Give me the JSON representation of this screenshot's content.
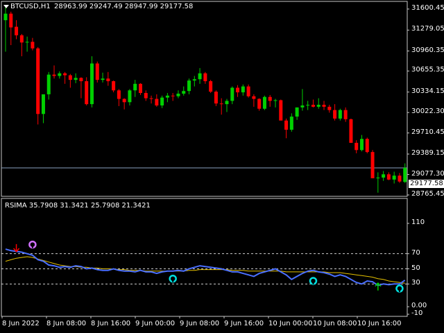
{
  "main_chart": {
    "symbol_label": "BTCUSD,H1",
    "ohlc_text": "28963.99 29247.49 28947.99 29177.58",
    "current_price": "29177.58",
    "y_labels": [
      "31600.45",
      "31279.05",
      "30960.35",
      "30655.35",
      "30334.15",
      "30022.30",
      "29710.45",
      "29389.15",
      "29077.30",
      "28765.45"
    ]
  },
  "indicator": {
    "label": "RSIMA 35.7908 31.3421 25.7908 21.3421",
    "y_labels": [
      "110",
      "70",
      "50",
      "30",
      "0.00",
      "-10"
    ]
  },
  "x_labels": [
    "8 Jun 2022",
    "8 Jun 08:00",
    "8 Jun 16:00",
    "9 Jun 00:00",
    "9 Jun 08:00",
    "9 Jun 16:00",
    "10 Jun 00:00",
    "10 Jun 08:00",
    "10 Jun 16:00"
  ],
  "colors": {
    "bull": "#00d000",
    "bear": "#ff0000",
    "rsi_line": "#4a6fff",
    "ma_line": "#e6c200",
    "grid": "#c8c8c8",
    "signal_cyan": "#00e0e0",
    "signal_violet": "#d070ff"
  },
  "chart_data": {
    "type": "candlestick",
    "candles": [
      {
        "o": 31430,
        "h": 31660,
        "l": 30950,
        "c": 31530
      },
      {
        "o": 31530,
        "h": 31560,
        "l": 31050,
        "c": 31320
      },
      {
        "o": 31330,
        "h": 31430,
        "l": 31140,
        "c": 31200
      },
      {
        "o": 31200,
        "h": 31220,
        "l": 30880,
        "c": 31090
      },
      {
        "o": 31090,
        "h": 31180,
        "l": 30950,
        "c": 31100
      },
      {
        "o": 31100,
        "h": 31160,
        "l": 30970,
        "c": 31000
      },
      {
        "o": 31000,
        "h": 31020,
        "l": 29840,
        "c": 30000
      },
      {
        "o": 30000,
        "h": 30300,
        "l": 29860,
        "c": 30300
      },
      {
        "o": 30300,
        "h": 30640,
        "l": 30220,
        "c": 30600
      },
      {
        "o": 30600,
        "h": 30740,
        "l": 30540,
        "c": 30580
      },
      {
        "o": 30580,
        "h": 30650,
        "l": 30540,
        "c": 30620
      },
      {
        "o": 30620,
        "h": 30640,
        "l": 30460,
        "c": 30590
      },
      {
        "o": 30590,
        "h": 30610,
        "l": 30400,
        "c": 30520
      },
      {
        "o": 30520,
        "h": 30620,
        "l": 30470,
        "c": 30550
      },
      {
        "o": 30550,
        "h": 30560,
        "l": 30240,
        "c": 30500
      },
      {
        "o": 30500,
        "h": 30560,
        "l": 30130,
        "c": 30150
      },
      {
        "o": 30150,
        "h": 30880,
        "l": 30100,
        "c": 30770
      },
      {
        "o": 30770,
        "h": 30800,
        "l": 30480,
        "c": 30520
      },
      {
        "o": 30520,
        "h": 30630,
        "l": 30480,
        "c": 30540
      },
      {
        "o": 30540,
        "h": 30640,
        "l": 30430,
        "c": 30500
      },
      {
        "o": 30500,
        "h": 30510,
        "l": 30330,
        "c": 30360
      },
      {
        "o": 30360,
        "h": 30380,
        "l": 30120,
        "c": 30230
      },
      {
        "o": 30230,
        "h": 30240,
        "l": 30070,
        "c": 30180
      },
      {
        "o": 30180,
        "h": 30380,
        "l": 30130,
        "c": 30360
      },
      {
        "o": 30360,
        "h": 30520,
        "l": 30260,
        "c": 30460
      },
      {
        "o": 30460,
        "h": 30470,
        "l": 30290,
        "c": 30320
      },
      {
        "o": 30320,
        "h": 30360,
        "l": 30200,
        "c": 30240
      },
      {
        "o": 30240,
        "h": 30280,
        "l": 30160,
        "c": 30230
      },
      {
        "o": 30230,
        "h": 30300,
        "l": 30110,
        "c": 30130
      },
      {
        "o": 30130,
        "h": 30280,
        "l": 30090,
        "c": 30250
      },
      {
        "o": 30250,
        "h": 30320,
        "l": 30180,
        "c": 30280
      },
      {
        "o": 30280,
        "h": 30320,
        "l": 30200,
        "c": 30270
      },
      {
        "o": 30270,
        "h": 30360,
        "l": 30240,
        "c": 30310
      },
      {
        "o": 30310,
        "h": 30420,
        "l": 30280,
        "c": 30350
      },
      {
        "o": 30350,
        "h": 30540,
        "l": 30300,
        "c": 30510
      },
      {
        "o": 30510,
        "h": 30580,
        "l": 30420,
        "c": 30530
      },
      {
        "o": 30530,
        "h": 30700,
        "l": 30460,
        "c": 30620
      },
      {
        "o": 30620,
        "h": 30640,
        "l": 30460,
        "c": 30500
      },
      {
        "o": 30500,
        "h": 30520,
        "l": 30320,
        "c": 30340
      },
      {
        "o": 30340,
        "h": 30360,
        "l": 30120,
        "c": 30160
      },
      {
        "o": 30160,
        "h": 30240,
        "l": 29990,
        "c": 30150
      },
      {
        "o": 30150,
        "h": 30230,
        "l": 30030,
        "c": 30200
      },
      {
        "o": 30200,
        "h": 30420,
        "l": 30150,
        "c": 30400
      },
      {
        "o": 30400,
        "h": 30440,
        "l": 30260,
        "c": 30330
      },
      {
        "o": 30330,
        "h": 30450,
        "l": 30280,
        "c": 30420
      },
      {
        "o": 30420,
        "h": 30450,
        "l": 30250,
        "c": 30270
      },
      {
        "o": 30270,
        "h": 30300,
        "l": 30110,
        "c": 30230
      },
      {
        "o": 30230,
        "h": 30240,
        "l": 30050,
        "c": 30080
      },
      {
        "o": 30080,
        "h": 30280,
        "l": 30060,
        "c": 30260
      },
      {
        "o": 30260,
        "h": 30290,
        "l": 30110,
        "c": 30200
      },
      {
        "o": 30200,
        "h": 30230,
        "l": 30100,
        "c": 30210
      },
      {
        "o": 30210,
        "h": 30220,
        "l": 29920,
        "c": 29900
      },
      {
        "o": 29900,
        "h": 29930,
        "l": 29630,
        "c": 29760
      },
      {
        "o": 29760,
        "h": 30010,
        "l": 29730,
        "c": 29960
      },
      {
        "o": 29960,
        "h": 30100,
        "l": 29910,
        "c": 30100
      },
      {
        "o": 30100,
        "h": 30380,
        "l": 30050,
        "c": 30130
      },
      {
        "o": 30130,
        "h": 30200,
        "l": 30060,
        "c": 30140
      },
      {
        "o": 30140,
        "h": 30220,
        "l": 30100,
        "c": 30110
      },
      {
        "o": 30110,
        "h": 30240,
        "l": 30080,
        "c": 30140
      },
      {
        "o": 30140,
        "h": 30200,
        "l": 30060,
        "c": 30110
      },
      {
        "o": 30110,
        "h": 30140,
        "l": 30020,
        "c": 30060
      },
      {
        "o": 30060,
        "h": 30150,
        "l": 29900,
        "c": 29930
      },
      {
        "o": 29930,
        "h": 30080,
        "l": 29900,
        "c": 30060
      },
      {
        "o": 30060,
        "h": 30100,
        "l": 29880,
        "c": 29920
      },
      {
        "o": 29920,
        "h": 29930,
        "l": 29560,
        "c": 29560
      },
      {
        "o": 29560,
        "h": 29600,
        "l": 29400,
        "c": 29450
      },
      {
        "o": 29450,
        "h": 29680,
        "l": 29430,
        "c": 29620
      },
      {
        "o": 29620,
        "h": 29640,
        "l": 29400,
        "c": 29420
      },
      {
        "o": 29420,
        "h": 29450,
        "l": 29130,
        "c": 29020
      },
      {
        "o": 29020,
        "h": 29110,
        "l": 28800,
        "c": 29030
      },
      {
        "o": 29030,
        "h": 29130,
        "l": 28980,
        "c": 29080
      },
      {
        "o": 29080,
        "h": 29110,
        "l": 28990,
        "c": 29000
      },
      {
        "o": 29000,
        "h": 29120,
        "l": 28940,
        "c": 29060
      },
      {
        "o": 29060,
        "h": 29100,
        "l": 28950,
        "c": 28970
      },
      {
        "o": 28964,
        "h": 29247,
        "l": 28948,
        "c": 29178
      }
    ],
    "rsi": [
      76,
      74,
      73,
      72,
      70,
      68,
      62,
      60,
      55,
      54,
      52,
      53,
      52,
      54,
      53,
      50,
      51,
      49,
      48,
      48,
      50,
      48,
      47,
      47,
      46,
      48,
      46,
      46,
      44,
      46,
      47,
      47,
      48,
      47,
      50,
      52,
      54,
      53,
      52,
      51,
      50,
      48,
      46,
      46,
      44,
      42,
      40,
      44,
      46,
      48,
      50,
      46,
      42,
      36,
      40,
      44,
      47,
      48,
      46,
      45,
      43,
      40,
      42,
      40,
      36,
      32,
      30,
      34,
      33,
      28,
      30,
      29,
      30,
      30,
      35
    ],
    "ma": [
      60,
      62,
      64,
      65,
      66,
      65,
      63,
      61,
      59,
      57,
      55,
      54,
      53,
      53,
      52,
      52,
      51,
      51,
      50,
      50,
      50,
      49,
      49,
      48,
      48,
      48,
      47,
      47,
      47,
      47,
      47,
      47,
      47,
      47,
      48,
      48,
      49,
      49,
      49,
      49,
      49,
      49,
      48,
      48,
      48,
      47,
      47,
      47,
      47,
      47,
      47,
      47,
      46,
      46,
      46,
      46,
      46,
      46,
      46,
      46,
      45,
      45,
      45,
      44,
      43,
      42,
      41,
      40,
      39,
      37,
      36,
      34,
      33,
      32,
      31
    ],
    "signals": [
      {
        "index": 2,
        "value": 78,
        "kind": "arrow-down",
        "color": "bear"
      },
      {
        "index": 5,
        "value": 82,
        "kind": "ring",
        "color": "signal_violet"
      },
      {
        "index": 31,
        "value": 37,
        "kind": "ring",
        "color": "signal_cyan"
      },
      {
        "index": 57,
        "value": 34,
        "kind": "ring",
        "color": "signal_cyan"
      },
      {
        "index": 69,
        "value": 26,
        "kind": "arrow-up",
        "color": "bull"
      },
      {
        "index": 73,
        "value": 24,
        "kind": "ring",
        "color": "signal_cyan"
      }
    ]
  }
}
